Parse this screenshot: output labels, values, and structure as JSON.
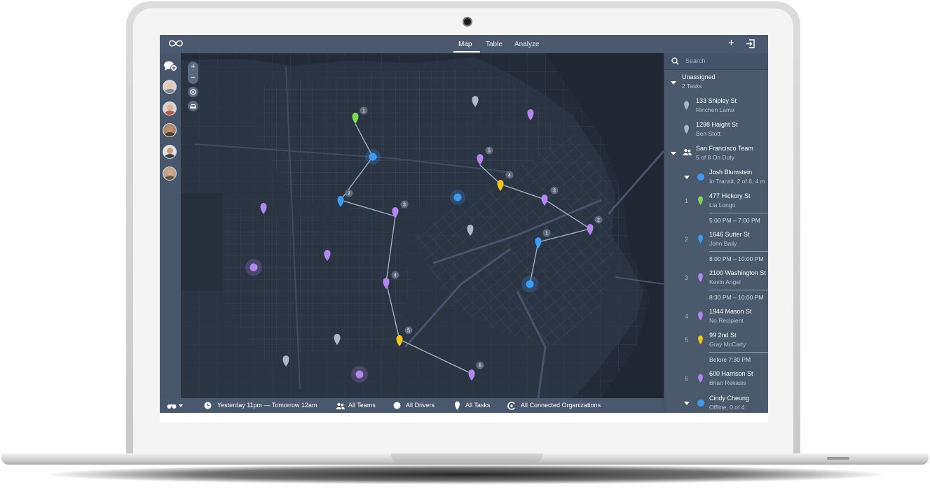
{
  "topbar": {
    "tabs": [
      {
        "label": "Map",
        "active": true
      },
      {
        "label": "Table",
        "active": false
      },
      {
        "label": "Analyze",
        "active": false
      }
    ],
    "icons": [
      "infinity-logo-icon",
      "plus-icon",
      "sign-in-icon"
    ]
  },
  "map": {
    "zoom_in": "+",
    "zoom_out": "−",
    "pin_colors": {
      "green": "#7ed957",
      "blue": "#3b9cf3",
      "purple": "#b487f0",
      "yellow": "#f5c518",
      "gray": "#aeb8c5"
    },
    "route_labels": [
      "1",
      "2",
      "3",
      "4",
      "5",
      "6",
      "5",
      "4",
      "3",
      "2",
      "1"
    ]
  },
  "search": {
    "placeholder": "Search"
  },
  "panel": {
    "unassigned": {
      "title": "Unassigned",
      "count": "2 Tasks"
    },
    "unassigned_tasks": [
      {
        "address": "133 Shipley St",
        "recipient": "Rinchen Lama"
      },
      {
        "address": "1298 Haight St",
        "recipient": "Ben Stott"
      }
    ],
    "team": {
      "title": "San Francisco Team",
      "status": "5 of 8 On Duty"
    },
    "driver": {
      "name": "Josh Blumstein",
      "status": "In Transit, 2 of 6, 4 m"
    },
    "tasks": [
      {
        "n": "1",
        "address": "477 Hickory St",
        "recipient": "Lia Longo",
        "window": "5:00 PM – 7:00 PM",
        "color": "#7ed957"
      },
      {
        "n": "2",
        "address": "1646 Sutter St",
        "recipient": "John Baily",
        "window": "8:00 PM – 10:00 PM",
        "color": "#3b9cf3"
      },
      {
        "n": "3",
        "address": "2100 Washington St",
        "recipient": "Kevin Angel",
        "window": "8:30 PM – 10:00 PM",
        "color": "#b487f0"
      },
      {
        "n": "4",
        "address": "1944 Mason St",
        "recipient": "No Recipient",
        "window": "",
        "color": "#b487f0"
      },
      {
        "n": "5",
        "address": "99 2nd St",
        "recipient": "Gray McCarty",
        "window": "Before 7:30 PM",
        "color": "#f5c518"
      },
      {
        "n": "6",
        "address": "600 Harrison St",
        "recipient": "Brian Rekasis",
        "window": "",
        "color": "#b487f0"
      }
    ],
    "driver2": {
      "name": "Cindy Cheung",
      "status": "Offline, 0 of 4"
    }
  },
  "bottombar": {
    "time": "Yesterday 11pm — Tomorrow 12am",
    "teams": "All Teams",
    "drivers": "All Drivers",
    "tasks": "All Tasks",
    "orgs": "All Connected Organizations"
  }
}
